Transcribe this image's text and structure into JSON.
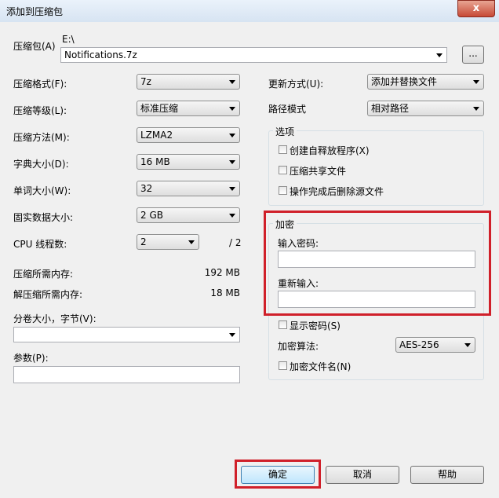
{
  "window": {
    "title": "添加到压缩包",
    "close_glyph": "x"
  },
  "archive": {
    "label": "压缩包(A)",
    "path": "E:\\",
    "filename": "Notifications.7z",
    "browse_label": "..."
  },
  "left": {
    "format": {
      "label": "压缩格式(F):",
      "value": "7z"
    },
    "level": {
      "label": "压缩等级(L):",
      "value": "标准压缩"
    },
    "method": {
      "label": "压缩方法(M):",
      "value": "LZMA2"
    },
    "dict": {
      "label": "字典大小(D):",
      "value": "16 MB"
    },
    "word": {
      "label": "单词大小(W):",
      "value": "32"
    },
    "solid": {
      "label": "固实数据大小:",
      "value": "2 GB"
    },
    "cpu": {
      "label": "CPU 线程数:",
      "value": "2",
      "total": "/ 2"
    },
    "mem_compress": {
      "label": "压缩所需内存:",
      "value": "192 MB"
    },
    "mem_decompress": {
      "label": "解压缩所需内存:",
      "value": "18 MB"
    },
    "split": {
      "label": "分卷大小，字节(V):",
      "value": ""
    },
    "params": {
      "label": "参数(P):",
      "value": ""
    }
  },
  "right": {
    "update": {
      "label": "更新方式(U):",
      "value": "添加并替换文件"
    },
    "pathmode": {
      "label": "路径模式",
      "value": "相对路径"
    },
    "options": {
      "title": "选项",
      "items": [
        {
          "label": "创建自释放程序(X)",
          "checked": false
        },
        {
          "label": "压缩共享文件",
          "checked": false
        },
        {
          "label": "操作完成后删除源文件",
          "checked": false
        }
      ]
    },
    "encryption": {
      "title": "加密",
      "password_label": "输入密码:",
      "password_value": "",
      "reenter_label": "重新输入:",
      "reenter_value": "",
      "show_password_label": "显示密码(S)",
      "method_label": "加密算法:",
      "method_value": "AES-256",
      "encrypt_names_label": "加密文件名(N)"
    }
  },
  "buttons": {
    "ok": "确定",
    "cancel": "取消",
    "help": "帮助"
  },
  "colors": {
    "highlight": "#d0202a",
    "default_button_border": "#3c7fb1"
  }
}
